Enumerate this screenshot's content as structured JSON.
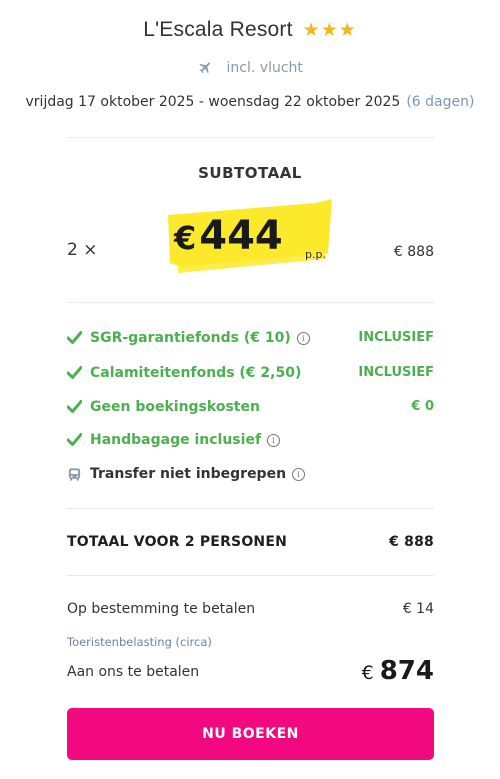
{
  "header": {
    "hotel_name": "L'Escala Resort",
    "stars": 3,
    "stars_text": "★★★",
    "flight_icon": "plane-icon",
    "flight_text": "incl. vlucht",
    "dates_text": "vrijdag 17 oktober 2025 - woensdag 22 oktober 2025",
    "duration_text": "(6 dagen)"
  },
  "subtotal": {
    "label": "SUBTOTAAL",
    "quantity": "2 ×",
    "currency_symbol": "€",
    "price_per_person": "444",
    "per_person_label": "p.p.",
    "line_total": "€ 888"
  },
  "features": [
    {
      "icon": "check-icon",
      "label": "SGR-garantiefonds  (€ 10)",
      "info": true,
      "value": "INCLUSIEF"
    },
    {
      "icon": "check-icon",
      "label": "Calamiteitenfonds  (€ 2,50)",
      "info": false,
      "value": "INCLUSIEF"
    },
    {
      "icon": "check-icon",
      "label": "Geen boekingskosten",
      "info": false,
      "value": "€ 0"
    },
    {
      "icon": "check-icon",
      "label": "Handbagage inclusief",
      "info": true,
      "value": ""
    },
    {
      "icon": "bus-icon",
      "label": "Transfer niet inbegrepen",
      "info": true,
      "value": ""
    }
  ],
  "totals": {
    "total_label": "TOTAAL VOOR 2 PERSONEN",
    "total_value": "€ 888",
    "destination_label": "Op bestemming te betalen",
    "destination_value": "€ 14",
    "tax_note": "Toeristenbelasting (circa)",
    "pay_label": "Aan ons te betalen",
    "pay_currency": "€",
    "pay_value": "874"
  },
  "actions": {
    "book_label": "NU BOEKEN"
  },
  "colors": {
    "accent": "#f2097f",
    "positive": "#4cb04f",
    "highlight": "#fde92b",
    "star": "#f3b61f"
  }
}
